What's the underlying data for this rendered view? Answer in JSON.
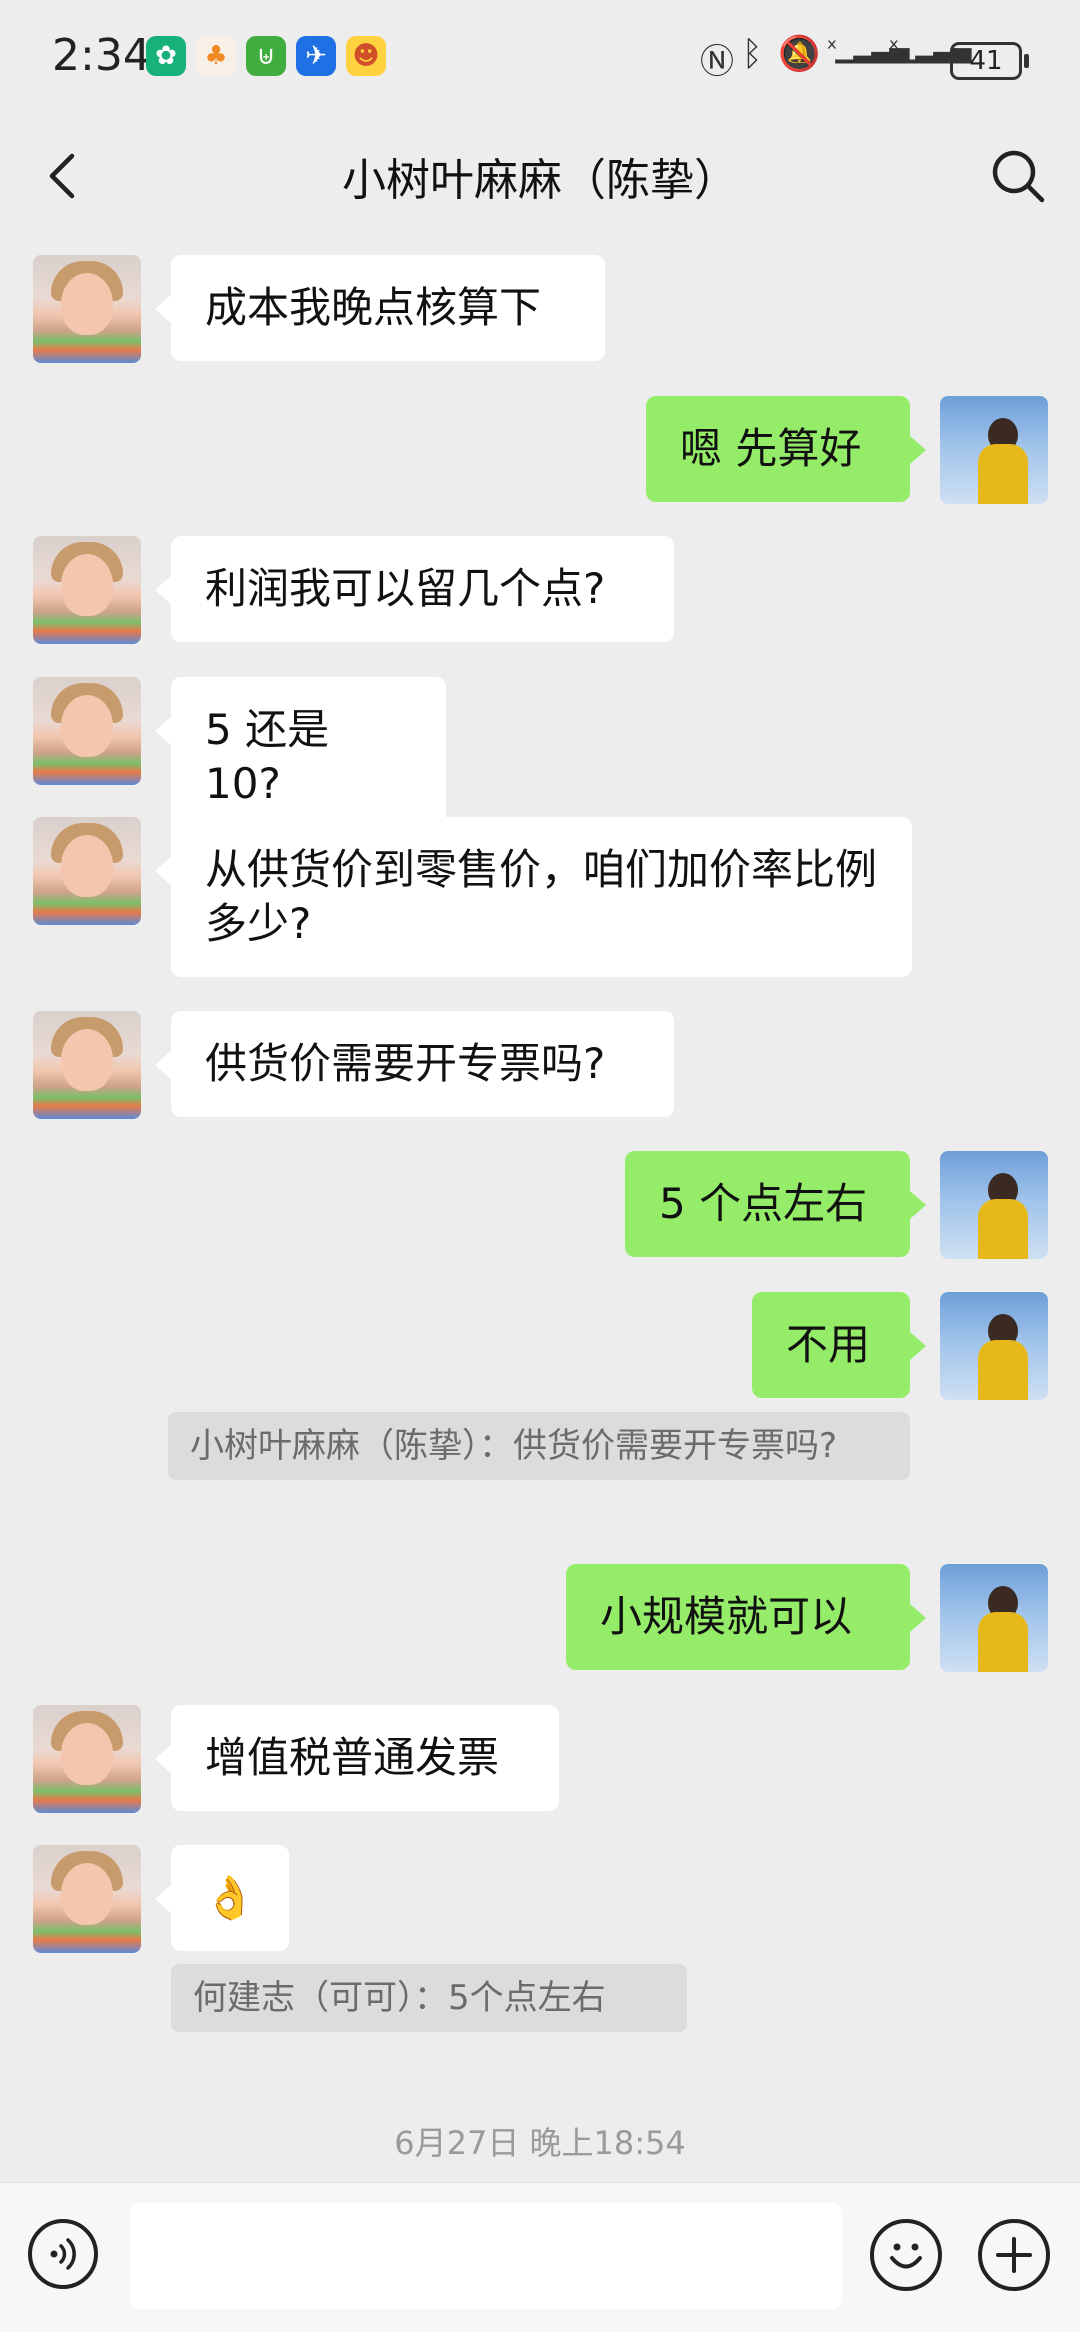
{
  "status_bar": {
    "time": "2:34",
    "battery": "41",
    "icons": [
      "app-green-icon",
      "app-orange-icon",
      "app-green2-icon",
      "app-blue-plane-icon",
      "app-duck-icon",
      "nfc-icon",
      "bluetooth-icon",
      "bell-muted-icon",
      "signal-1-icon",
      "signal-2-icon"
    ]
  },
  "header": {
    "title": "小树叶麻麻（陈挚）"
  },
  "messages": [
    {
      "side": "left",
      "text": "成本我晚点核算下"
    },
    {
      "side": "right",
      "text": "嗯 先算好"
    },
    {
      "side": "left",
      "text": "利润我可以留几个点?"
    },
    {
      "side": "left",
      "text": "5 还是 10?"
    },
    {
      "side": "left",
      "text": "从供货价到零售价，咱们加价率比例多少?"
    },
    {
      "side": "left",
      "text": "供货价需要开专票吗?"
    },
    {
      "side": "right",
      "text": "5 个点左右"
    },
    {
      "side": "right",
      "text": "不用"
    },
    {
      "side": "quote",
      "text": "小树叶麻麻（陈挚）：供货价需要开专票吗?"
    },
    {
      "side": "right",
      "text": "小规模就可以"
    },
    {
      "side": "left",
      "text": "增值税普通发票"
    },
    {
      "side": "left",
      "text": "👌"
    },
    {
      "side": "quote",
      "text": "何建志（可可）：5个点左右"
    }
  ],
  "timestamp": "6月27日 晚上18:54",
  "input": {
    "value": "",
    "placeholder": ""
  },
  "colors": {
    "bg": "#ededed",
    "my_bubble": "#95ec69",
    "their_bubble": "#ffffff",
    "quote": "#dcdcdc"
  }
}
